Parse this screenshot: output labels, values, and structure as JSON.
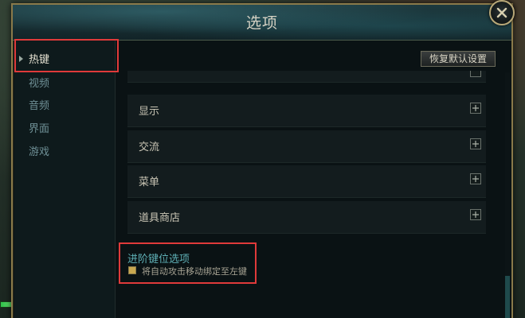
{
  "dialog": {
    "title": "选项"
  },
  "sidebar": {
    "items": [
      {
        "label": "热键",
        "active": true
      },
      {
        "label": "视频",
        "active": false
      },
      {
        "label": "音频",
        "active": false
      },
      {
        "label": "界面",
        "active": false
      },
      {
        "label": "游戏",
        "active": false
      }
    ]
  },
  "toolbar": {
    "reset_label": "恢复默认设置"
  },
  "sections": [
    {
      "label": "显示"
    },
    {
      "label": "交流"
    },
    {
      "label": "菜单"
    },
    {
      "label": "道具商店"
    }
  ],
  "advanced": {
    "title": "进阶键位选项",
    "checkbox_label": "将自动攻击移动绑定至左键",
    "checkbox_checked": true
  },
  "colors": {
    "frame_gold": "#8a7a4a",
    "highlight_red": "#e03a3a",
    "accent_teal": "#5fb0b6"
  },
  "icons": {
    "close": "close-icon",
    "expand": "plus-icon",
    "active_marker": "caret-right-icon"
  }
}
